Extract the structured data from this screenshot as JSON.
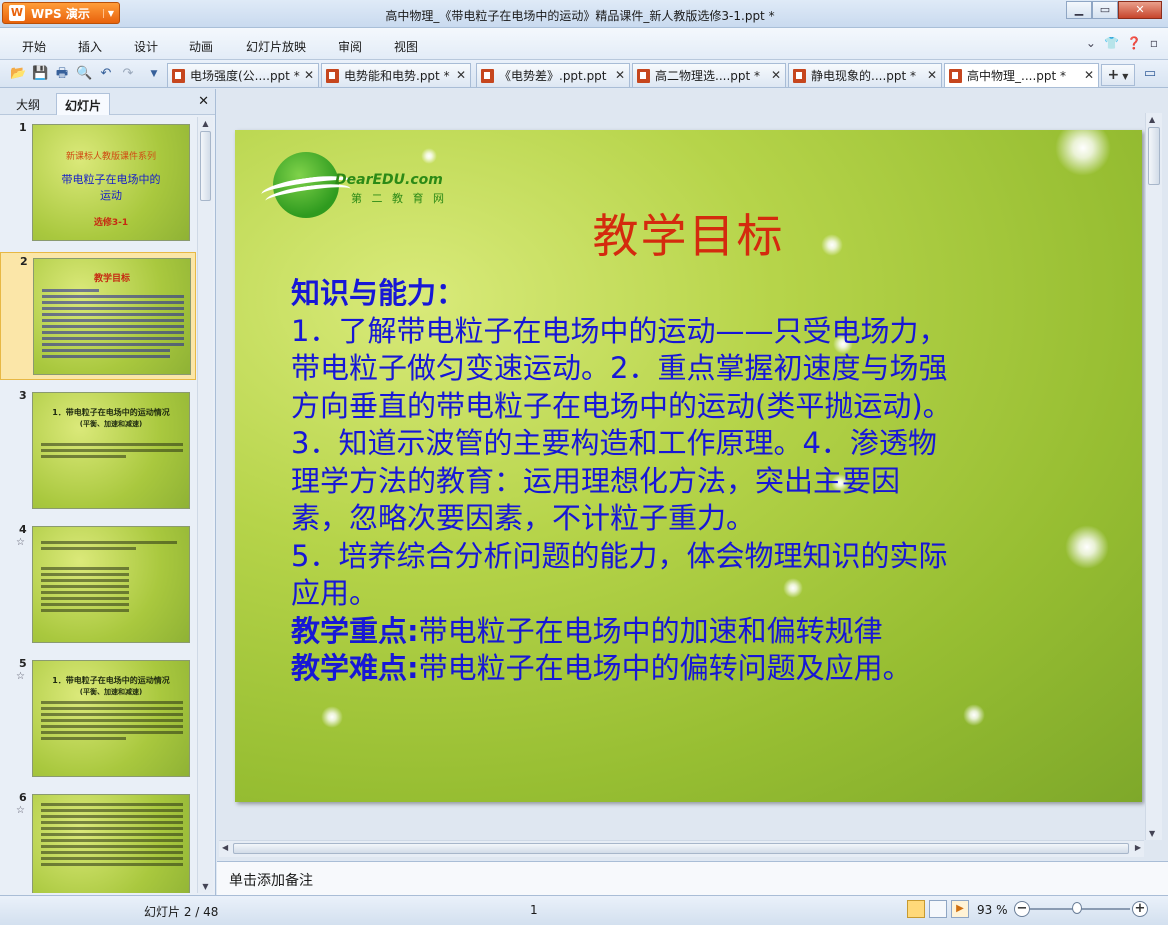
{
  "app": {
    "name": "WPS 演示",
    "window_title": "高中物理_《带电粒子在电场中的运动》精品课件_新人教版选修3-1.ppt *"
  },
  "menu": [
    "开始",
    "插入",
    "设计",
    "动画",
    "幻灯片放映",
    "审阅",
    "视图"
  ],
  "tabs": [
    {
      "label": "电场强度(公....ppt *"
    },
    {
      "label": "电势能和电势.ppt *"
    },
    {
      "label": "《电势差》.ppt.ppt"
    },
    {
      "label": "高二物理选....ppt *"
    },
    {
      "label": "静电现象的....ppt *"
    },
    {
      "label": "高中物理_....ppt *"
    }
  ],
  "left_panel": {
    "tab_outline": "大纲",
    "tab_slides": "幻灯片",
    "thumbnails": [
      {
        "number": "1",
        "line1": "新课标人教版课件系列",
        "line2": "带电粒子在电场中的",
        "line3": "运动",
        "line4": "选修3-1"
      },
      {
        "number": "2",
        "title": "教学目标"
      },
      {
        "number": "3",
        "heading": "1．带电粒子在电场中的运动情况",
        "sub": "(平衡、加速和减速)"
      },
      {
        "number": "4"
      },
      {
        "number": "5",
        "heading": "1．带电粒子在电场中的运动情况",
        "sub": "(平衡、加速和减速)"
      },
      {
        "number": "6"
      }
    ]
  },
  "slide": {
    "logo_text": "DearEDU.com",
    "logo_sub": "第 二 教 育 网",
    "title": "教学目标",
    "heading": "知识与能力：",
    "p1": "1．了解带电粒子在电场中的运动——只受电场力，",
    "p2": "带电粒子做匀变速运动。2．重点掌握初速度与场强",
    "p3": "方向垂直的带电粒子在电场中的运动(类平抛运动)。",
    "p4": "3．知道示波管的主要构造和工作原理。4．渗透物",
    "p5": "理学方法的教育：运用理想化方法，突出主要因",
    "p6": "素，忽略次要因素，不计粒子重力。",
    "p7": "5．培养综合分析问题的能力，体会物理知识的实际",
    "p8": "应用。",
    "key_label": "教学重点:",
    "key_text": "带电粒子在电场中的加速和偏转规律",
    "diff_label": "教学难点:",
    "diff_text": "带电粒子在电场中的偏转问题及应用。"
  },
  "notes_placeholder": "单击添加备注",
  "status": {
    "slide_indicator": "幻灯片 2 / 48",
    "center_value": "1",
    "zoom": "93 %"
  }
}
